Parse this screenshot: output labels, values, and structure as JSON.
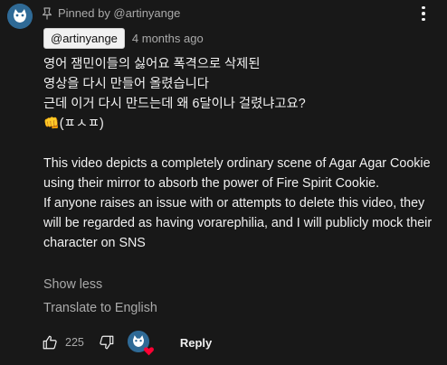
{
  "pinned": {
    "text": "Pinned by @artinyange"
  },
  "comment": {
    "author": "@artinyange",
    "time": "4 months ago",
    "paragraphs": [
      "영어 잼민이들의 싫어요 폭격으로 삭제된",
      "영상을 다시 만들어 올렸습니다",
      "근데 이거 다시 만드는데 왜 6달이나 걸렸냐고요?",
      "👊(ㅍㅅㅍ)",
      "",
      "This video depicts a completely ordinary scene of Agar Agar Cookie using their mirror to absorb the power of Fire Spirit Cookie.",
      "If anyone raises an issue with or attempts to delete this video, they will be regarded as having vorarephilia, and I will publicly mock their character on SNS"
    ]
  },
  "actions": {
    "show_less": "Show less",
    "translate": "Translate to English",
    "like_count": "225",
    "reply": "Reply"
  },
  "icons": {
    "pin": "pin-icon",
    "menu": "vertical-dots-icon",
    "like": "thumbs-up-icon",
    "dislike": "thumbs-down-icon",
    "heart": "heart-icon"
  },
  "colors": {
    "background": "#181818",
    "text": "#f1f1f1",
    "secondary_text": "#aaaaaa",
    "avatar": "#2f6a96",
    "heart": "#ff0033"
  }
}
